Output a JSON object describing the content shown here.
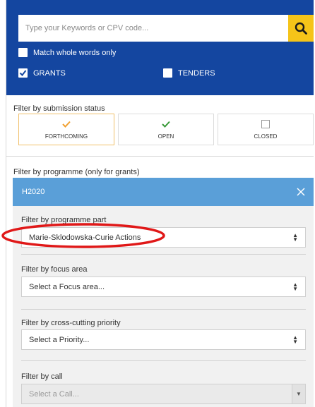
{
  "search": {
    "placeholder": "Type your Keywords or CPV code...",
    "match_whole_words_label": "Match whole words only",
    "match_whole_words_checked": false
  },
  "types": [
    {
      "label": "GRANTS",
      "checked": true
    },
    {
      "label": "TENDERS",
      "checked": false
    }
  ],
  "status_filter": {
    "label": "Filter by submission status",
    "options": [
      {
        "label": "FORTHCOMING",
        "checked": true,
        "check_color": "#f0a030"
      },
      {
        "label": "OPEN",
        "checked": true,
        "check_color": "#3a9a3a"
      },
      {
        "label": "CLOSED",
        "checked": false,
        "check_color": ""
      }
    ]
  },
  "programme_filter": {
    "label": "Filter by programme (only for grants)",
    "selected": "H2020",
    "fields": [
      {
        "label": "Filter by programme part",
        "value": "Marie-Sklodowska-Curie Actions",
        "disabled": false
      },
      {
        "label": "Filter by focus area",
        "value": "Select a Focus area...",
        "disabled": false
      },
      {
        "label": "Filter by cross-cutting priority",
        "value": "Select a Priority...",
        "disabled": false
      },
      {
        "label": "Filter by call",
        "value": "Select a Call...",
        "disabled": true
      }
    ]
  },
  "colors": {
    "header_bg": "#1446a0",
    "search_button": "#f5c419",
    "programme_header": "#5a9fd8",
    "annotation": "#e01818"
  }
}
